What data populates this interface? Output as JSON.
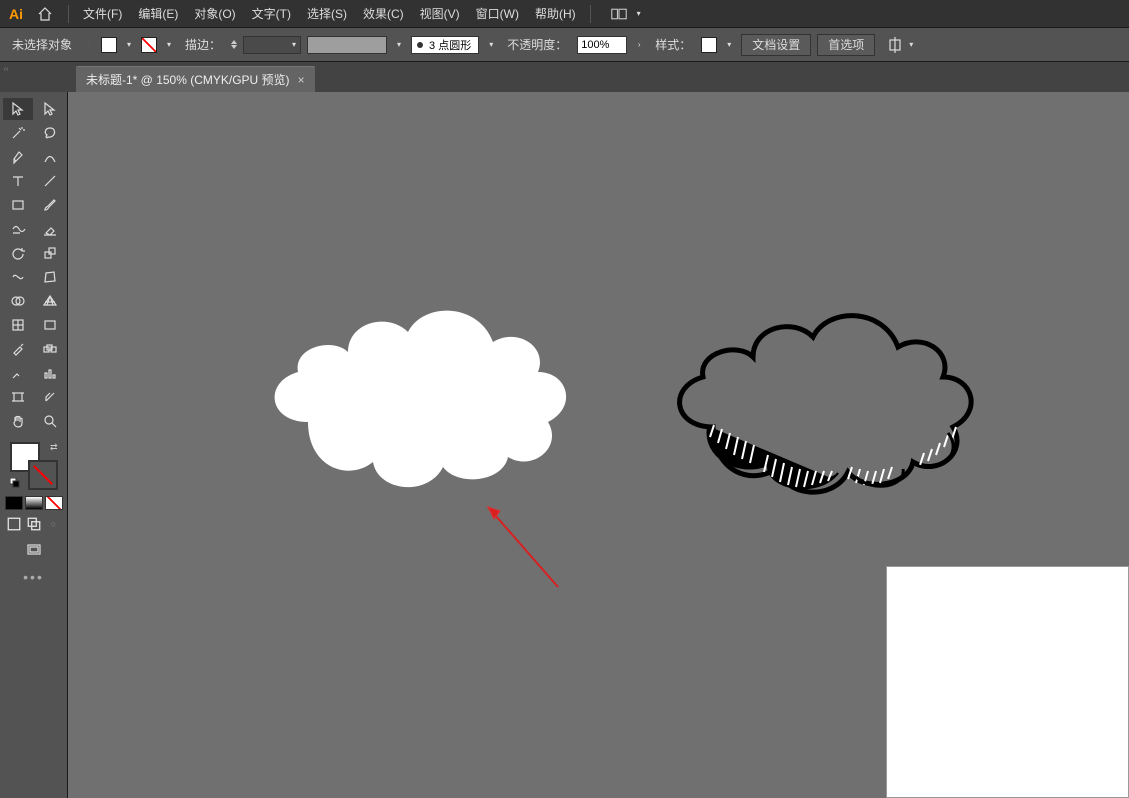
{
  "menu": {
    "items": [
      {
        "label": "文件(F)",
        "key": "F"
      },
      {
        "label": "编辑(E)",
        "key": "E"
      },
      {
        "label": "对象(O)",
        "key": "O"
      },
      {
        "label": "文字(T)",
        "key": "T"
      },
      {
        "label": "选择(S)",
        "key": "S"
      },
      {
        "label": "效果(C)",
        "key": "C"
      },
      {
        "label": "视图(V)",
        "key": "V"
      },
      {
        "label": "窗口(W)",
        "key": "W"
      },
      {
        "label": "帮助(H)",
        "key": "H"
      }
    ]
  },
  "controlbar": {
    "selection_status": "未选择对象",
    "stroke_label": "描边：",
    "stroke_style_value": "3 点圆形",
    "opacity_label": "不透明度：",
    "opacity_value": "100%",
    "style_label": "样式：",
    "doc_setup_btn": "文档设置",
    "preferences_btn": "首选项"
  },
  "document_tab": {
    "title": "未标题-1* @ 150% (CMYK/GPU 预览)"
  },
  "tools": {
    "list": [
      "selection",
      "direct-selection",
      "magic-wand",
      "lasso",
      "pen",
      "curvature",
      "type",
      "line-segment",
      "rectangle",
      "paintbrush",
      "shaper",
      "eraser",
      "rotate",
      "scale",
      "width",
      "free-transform",
      "shape-builder",
      "perspective",
      "mesh",
      "gradient",
      "eyedropper",
      "blend",
      "symbol-sprayer",
      "column-graph",
      "artboard",
      "slice",
      "hand",
      "zoom"
    ]
  },
  "colors": {
    "fill": "#ffffff",
    "stroke": "none"
  }
}
